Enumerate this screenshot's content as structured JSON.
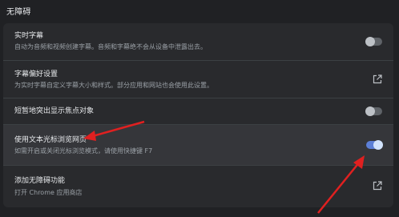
{
  "section_title": "无障碍",
  "settings": [
    {
      "label": "实时字幕",
      "description": "自动为音频和视频创建字幕。音频和字幕绝不会从设备中泄露出去。",
      "control": "toggle",
      "enabled": false
    },
    {
      "label": "字幕偏好设置",
      "description": "为实时字幕自定义字幕大小和样式。部分应用和网站也会使用此设置。",
      "control": "external-link"
    },
    {
      "label": "短暂地突出显示焦点对象",
      "description": "",
      "control": "toggle",
      "enabled": false
    },
    {
      "label": "使用文本光标浏览网页",
      "description": "如需开启或关闭光标浏览模式，请使用快捷键 F7",
      "control": "toggle",
      "enabled": true
    },
    {
      "label": "添加无障碍功能",
      "description": "打开 Chrome 应用商店",
      "control": "external-link"
    }
  ],
  "colors": {
    "background": "#202124",
    "card": "#292a2d",
    "highlight_row": "#35363a",
    "toggle_on": "#5c7fd6",
    "annotation_arrow": "#e02020"
  }
}
